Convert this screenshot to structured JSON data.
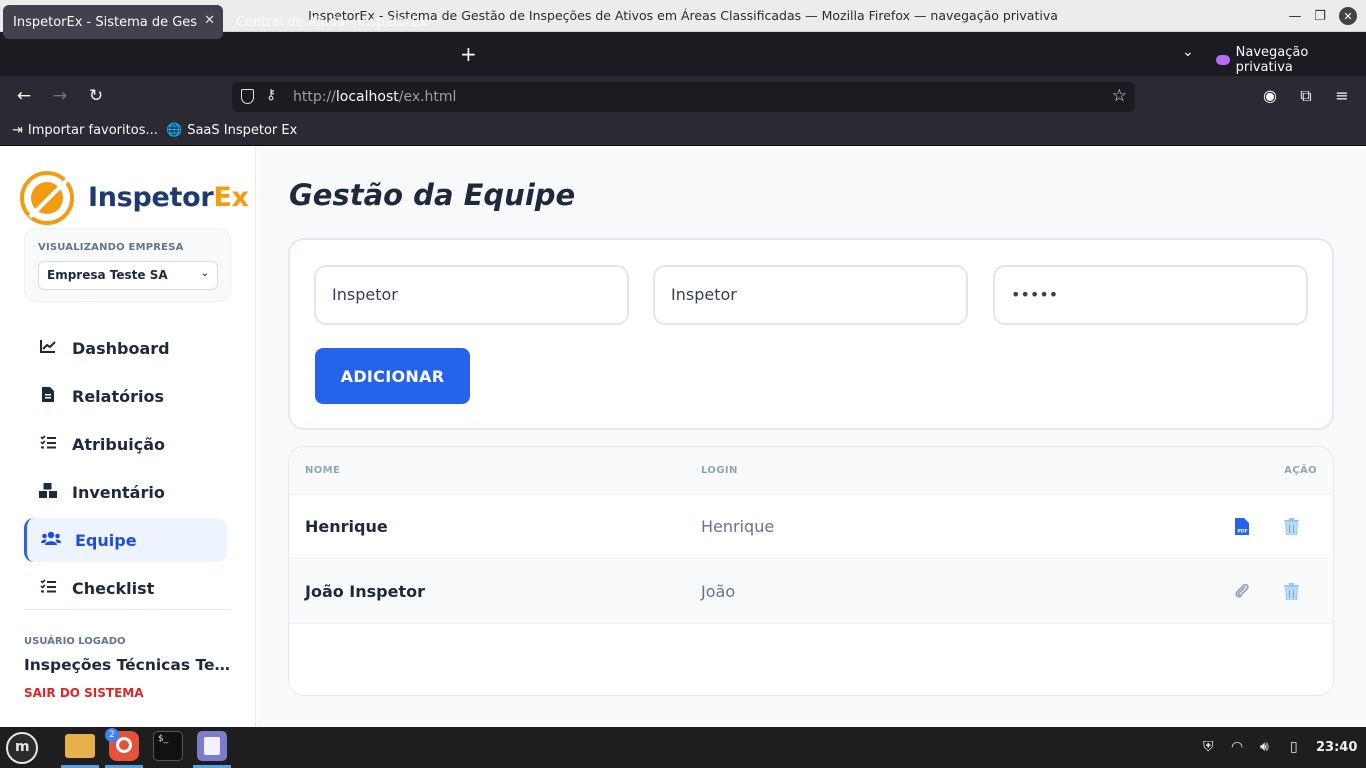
{
  "window": {
    "title": "InspetorEx - Sistema de Gestão de Inspeções de Ativos em Áreas Classificadas — Mozilla Firefox — navegação privativa"
  },
  "browser": {
    "tabs": [
      {
        "label": "InspetorEx - Sistema de Gestão",
        "active": true
      },
      {
        "label": "Central de Ajuda - InspetorEx",
        "active": false
      }
    ],
    "private_label": "Navegação privativa",
    "url_prefix": "http://",
    "url_host": "localhost",
    "url_path": "/ex.html",
    "bookmarks": [
      {
        "label": "Importar favoritos...",
        "icon": "import-icon"
      },
      {
        "label": "SaaS Inspetor Ex",
        "icon": "globe-icon"
      }
    ]
  },
  "sidebar": {
    "brand_part1": "Inspetor",
    "brand_part2": "Ex",
    "company_caption": "VISUALIZANDO EMPRESA",
    "company_selected": "Empresa Teste SA",
    "menu": [
      {
        "label": "Dashboard",
        "icon": "chart-line-icon",
        "active": false
      },
      {
        "label": "Relatórios",
        "icon": "file-icon",
        "active": false
      },
      {
        "label": "Atribuição",
        "icon": "list-check-icon",
        "active": false
      },
      {
        "label": "Inventário",
        "icon": "boxes-icon",
        "active": false
      },
      {
        "label": "Equipe",
        "icon": "users-icon",
        "active": true
      },
      {
        "label": "Checklist",
        "icon": "list-check-icon",
        "active": false
      }
    ],
    "user_caption": "USUÁRIO LOGADO",
    "user_name": "Inspeções Técnicas Terceirizadas",
    "logout": "SAIR DO SISTEMA"
  },
  "main": {
    "title": "Gestão da Equipe",
    "form": {
      "name_value": "Inspetor",
      "login_value": "Inspetor",
      "password_value": "•••••",
      "add_label": "ADICIONAR"
    },
    "table": {
      "headers": {
        "name": "NOME",
        "login": "LOGIN",
        "action": "AÇÃO"
      },
      "rows": [
        {
          "name": "Henrique",
          "login": "Henrique",
          "doc_icon": "pdf-file-icon"
        },
        {
          "name": "João Inspetor",
          "login": "João",
          "doc_icon": "paperclip-icon"
        }
      ]
    }
  },
  "taskbar": {
    "firefox_badge": "2",
    "clock": "23:40"
  },
  "colors": {
    "accent": "#2563eb",
    "brand_orange": "#f39c12",
    "brand_navy": "#1e3a6e",
    "danger": "#dc2626"
  }
}
